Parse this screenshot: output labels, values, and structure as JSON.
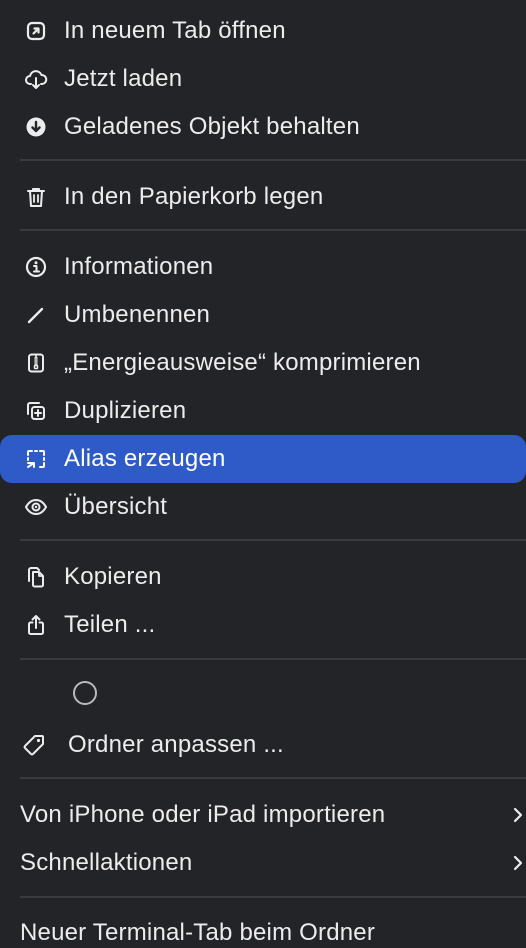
{
  "menu": {
    "items": [
      {
        "label": "In neuem Tab öffnen",
        "icon": "arrow-up-right-square-icon"
      },
      {
        "label": "Jetzt laden",
        "icon": "cloud-download-icon"
      },
      {
        "label": "Geladenes Objekt behalten",
        "icon": "arrow-down-circle-icon"
      },
      {
        "label": "In den Papierkorb legen",
        "icon": "trash-icon"
      },
      {
        "label": "Informationen",
        "icon": "info-circle-icon"
      },
      {
        "label": "Umbenennen",
        "icon": "pencil-icon"
      },
      {
        "label": "„Energieausweise“ komprimieren",
        "icon": "zip-archive-icon"
      },
      {
        "label": "Duplizieren",
        "icon": "plus-square-on-square-icon"
      },
      {
        "label": "Alias erzeugen",
        "icon": "alias-arrow-icon"
      },
      {
        "label": "Übersicht",
        "icon": "eye-icon"
      },
      {
        "label": "Kopieren",
        "icon": "doc-on-doc-icon"
      },
      {
        "label": "Teilen ...",
        "icon": "share-icon"
      },
      {
        "label": "Ordner anpassen ...",
        "icon": "tag-icon"
      },
      {
        "label": "Von iPhone oder iPad importieren",
        "icon": "chevron-right-icon"
      },
      {
        "label": "Schnellaktionen",
        "icon": "chevron-right-icon"
      },
      {
        "label": "Neuer Terminal-Tab beim Ordner",
        "icon": ""
      }
    ],
    "highlighted_index": 8,
    "colors": {
      "background": "#232427",
      "highlight": "#2f5bc9",
      "text": "#ececec",
      "separator": "#3a3b3e"
    }
  }
}
